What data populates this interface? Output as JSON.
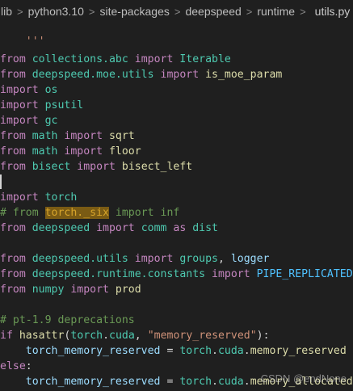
{
  "breadcrumb": {
    "items": [
      "lib",
      "python3.10",
      "site-packages",
      "deepspeed",
      "runtime",
      "utils.py"
    ],
    "separator": ">",
    "more": "..."
  },
  "file": {
    "icon": "python-file-icon",
    "language": "Python"
  },
  "code": {
    "header_fragment": "'''",
    "lines": [
      {
        "tokens": [
          [
            "from",
            "kw-flow"
          ],
          [
            " collections.abc ",
            "mod"
          ],
          [
            "import",
            "kw-flow"
          ],
          [
            " Iterable",
            "mod"
          ]
        ]
      },
      {
        "tokens": [
          [
            "from",
            "kw-flow"
          ],
          [
            " deepspeed.moe.utils ",
            "mod"
          ],
          [
            "import",
            "kw-flow"
          ],
          [
            " is_moe_param",
            "fn"
          ]
        ]
      },
      {
        "tokens": [
          [
            "import",
            "kw-flow"
          ],
          [
            " os",
            "mod"
          ]
        ]
      },
      {
        "tokens": [
          [
            "import",
            "kw-flow"
          ],
          [
            " psutil",
            "mod"
          ]
        ]
      },
      {
        "tokens": [
          [
            "import",
            "kw-flow"
          ],
          [
            " gc",
            "mod"
          ]
        ]
      },
      {
        "tokens": [
          [
            "from",
            "kw-flow"
          ],
          [
            " math ",
            "mod"
          ],
          [
            "import",
            "kw-flow"
          ],
          [
            " sqrt",
            "fn"
          ]
        ]
      },
      {
        "tokens": [
          [
            "from",
            "kw-flow"
          ],
          [
            " math ",
            "mod"
          ],
          [
            "import",
            "kw-flow"
          ],
          [
            " floor",
            "fn"
          ]
        ]
      },
      {
        "tokens": [
          [
            "from",
            "kw-flow"
          ],
          [
            " bisect ",
            "mod"
          ],
          [
            "import",
            "kw-flow"
          ],
          [
            " bisect_left",
            "fn"
          ]
        ]
      },
      {
        "tokens": [
          [
            "",
            "name"
          ]
        ]
      },
      {
        "tokens": [
          [
            "import",
            "kw-flow"
          ],
          [
            " torch",
            "mod"
          ]
        ]
      },
      {
        "tokens": [
          [
            "# from ",
            "comment"
          ],
          [
            "torch._six",
            "hl"
          ],
          [
            " import inf",
            "comment"
          ]
        ]
      },
      {
        "tokens": [
          [
            "from",
            "kw-flow"
          ],
          [
            " deepspeed ",
            "mod"
          ],
          [
            "import",
            "kw-flow"
          ],
          [
            " comm ",
            "mod"
          ],
          [
            "as",
            "kw-flow"
          ],
          [
            " dist",
            "mod"
          ]
        ]
      },
      {
        "tokens": [
          [
            "",
            "name"
          ]
        ]
      },
      {
        "tokens": [
          [
            "from",
            "kw-flow"
          ],
          [
            " deepspeed.utils ",
            "mod"
          ],
          [
            "import",
            "kw-flow"
          ],
          [
            " groups",
            "mod"
          ],
          [
            ", ",
            "punc"
          ],
          [
            "logger",
            "var"
          ]
        ]
      },
      {
        "tokens": [
          [
            "from",
            "kw-flow"
          ],
          [
            " deepspeed.runtime.constants ",
            "mod"
          ],
          [
            "import",
            "kw-flow"
          ],
          [
            " PIPE_REPLICATED",
            "const"
          ]
        ]
      },
      {
        "tokens": [
          [
            "from",
            "kw-flow"
          ],
          [
            " numpy ",
            "mod"
          ],
          [
            "import",
            "kw-flow"
          ],
          [
            " prod",
            "fn"
          ]
        ]
      },
      {
        "tokens": [
          [
            "",
            "name"
          ]
        ]
      },
      {
        "tokens": [
          [
            "# pt-1.9 deprecations",
            "comment"
          ]
        ]
      },
      {
        "tokens": [
          [
            "if",
            "kw-ctrl"
          ],
          [
            " ",
            "punc"
          ],
          [
            "hasattr",
            "fn"
          ],
          [
            "(",
            "punc"
          ],
          [
            "torch",
            "mod"
          ],
          [
            ".",
            "punc"
          ],
          [
            "cuda",
            "mod"
          ],
          [
            ", ",
            "punc"
          ],
          [
            "\"memory_reserved\"",
            "str"
          ],
          [
            "):",
            "punc"
          ]
        ]
      },
      {
        "tokens": [
          [
            "    ",
            "punc"
          ],
          [
            "torch_memory_reserved",
            "var"
          ],
          [
            " = ",
            "punc"
          ],
          [
            "torch",
            "mod"
          ],
          [
            ".",
            "punc"
          ],
          [
            "cuda",
            "mod"
          ],
          [
            ".",
            "punc"
          ],
          [
            "memory_reserved",
            "fn"
          ]
        ]
      },
      {
        "tokens": [
          [
            "else",
            "kw-ctrl"
          ],
          [
            ":",
            "punc"
          ]
        ]
      },
      {
        "tokens": [
          [
            "    ",
            "punc"
          ],
          [
            "torch_memory_reserved",
            "var"
          ],
          [
            " = ",
            "punc"
          ],
          [
            "torch",
            "mod"
          ],
          [
            ".",
            "punc"
          ],
          [
            "cuda",
            "mod"
          ],
          [
            ".",
            "punc"
          ],
          [
            "memory_allocated",
            "fn"
          ]
        ]
      }
    ]
  },
  "watermark": "CSDN @endNone"
}
